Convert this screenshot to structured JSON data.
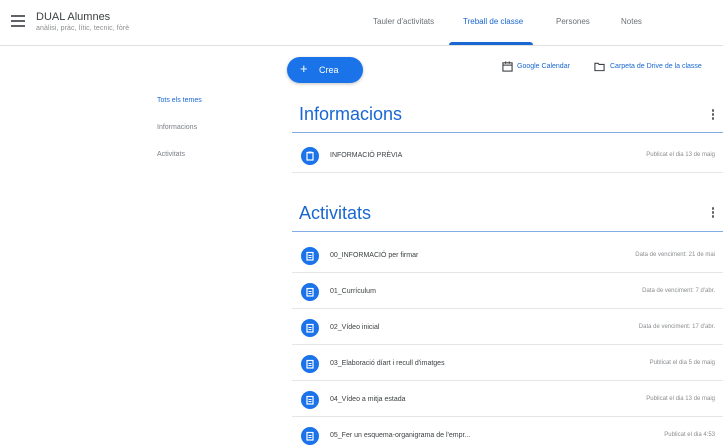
{
  "header": {
    "class_name": "DUAL Alumnes",
    "class_subtitle": "anàlisi, pràc, lític, tecnic, fòrè"
  },
  "tabs": [
    {
      "label": "Tauler d'activitats",
      "active": false
    },
    {
      "label": "Treball de classe",
      "active": true
    },
    {
      "label": "Persones",
      "active": false
    },
    {
      "label": "Notes",
      "active": false
    }
  ],
  "toolbar": {
    "create_label": "Crea",
    "calendar_label": "Google Calendar",
    "drive_label": "Carpeta de Drive de la classe"
  },
  "sidebar": {
    "items": [
      {
        "label": "Tots els temes",
        "active": true
      },
      {
        "label": "Informacions",
        "active": false
      },
      {
        "label": "Activitats",
        "active": false
      }
    ]
  },
  "sections": [
    {
      "title": "Informacions",
      "items": [
        {
          "title": "INFORMACIÓ PRÈVIA",
          "meta": "Publicat el dia 13 de maig"
        }
      ]
    },
    {
      "title": "Activitats",
      "items": [
        {
          "title": "00_INFORMACIÓ per firmar",
          "meta": "Data de venciment: 21 de mai"
        },
        {
          "title": "01_Currículum",
          "meta": "Data de venciment: 7 d'abr."
        },
        {
          "title": "02_Vídeo inicial",
          "meta": "Data de venciment: 17 d'abr."
        },
        {
          "title": "03_Elaboració díart i recull d'imatges",
          "meta": "Publicat el dia 5 de maig"
        },
        {
          "title": "04_Vídeo a mitja estada",
          "meta": "Publicat el dia 13 de maig"
        },
        {
          "title": "05_Fer un esquema-organigrama de l'empr...",
          "meta": "Publicat el dia 4:53"
        }
      ]
    }
  ],
  "colors": {
    "accent": "#1967d2",
    "button": "#1a73e8"
  }
}
